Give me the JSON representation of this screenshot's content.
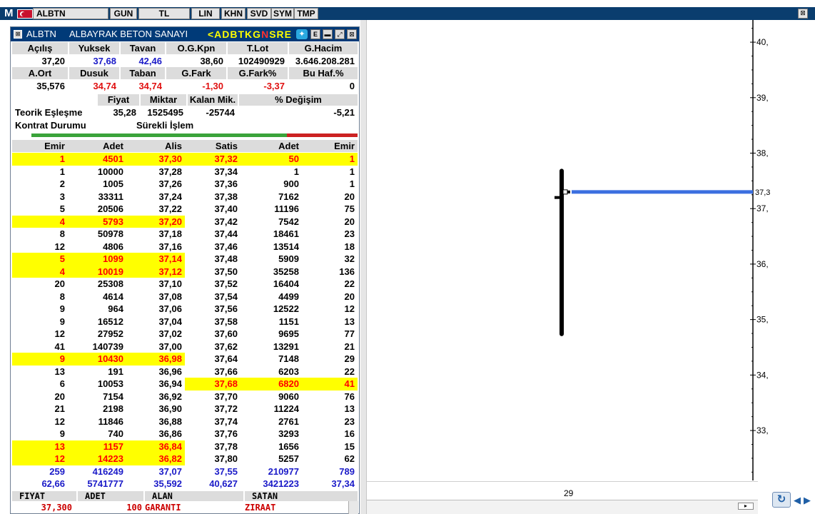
{
  "toolbar": {
    "menu_label": "M",
    "symbol": "ALBTN",
    "buttons": [
      "GUN",
      "TL",
      "LIN",
      "KHN",
      "SVD",
      "SYM",
      "TMP"
    ],
    "close_glyph": "⊠"
  },
  "depth": {
    "symbol": "ALBTN",
    "company": "ALBAYRAK BETON SANAYI",
    "ticker_a": "<ADBTKG",
    "ticker_b": "N",
    "ticker_c": "SRE",
    "btn_e": "E",
    "stats1": {
      "labels": [
        "Açılış",
        "Yuksek",
        "Tavan",
        "O.G.Kpn",
        "T.Lot",
        "G.Hacim"
      ],
      "values": [
        "37,20",
        "37,68",
        "42,46",
        "38,60",
        "102490929",
        "3.646.208.281"
      ]
    },
    "stats2": {
      "labels": [
        "A.Ort",
        "Dusuk",
        "Taban",
        "G.Fark",
        "G.Fark%",
        "Bu Haf.%"
      ],
      "values": [
        "35,576",
        "34,74",
        "34,74",
        "-1,30",
        "-3,37",
        "0"
      ]
    },
    "teorik": {
      "headers": [
        "Fiyat",
        "Miktar",
        "Kalan Mik.",
        "% Değişim"
      ],
      "row1_label": "Teorik Eşleşme",
      "row1_values": [
        "35,28",
        "1525495",
        "-25744",
        "-5,21"
      ],
      "row2_label": "Kontrat Durumu",
      "row2_value": "Sürekli İşlem"
    },
    "book_headers": [
      "Emir",
      "Adet",
      "Alis",
      "Satis",
      "Adet",
      "Emir"
    ],
    "book_rows": [
      {
        "c": [
          "1",
          "4501",
          "37,30",
          "37,32",
          "50",
          "1"
        ],
        "hb": true,
        "hs": true
      },
      {
        "c": [
          "1",
          "10000",
          "37,28",
          "37,34",
          "1",
          "1"
        ],
        "hb": false,
        "hs": false
      },
      {
        "c": [
          "2",
          "1005",
          "37,26",
          "37,36",
          "900",
          "1"
        ],
        "hb": false,
        "hs": false
      },
      {
        "c": [
          "3",
          "33311",
          "37,24",
          "37,38",
          "7162",
          "20"
        ],
        "hb": false,
        "hs": false
      },
      {
        "c": [
          "5",
          "20506",
          "37,22",
          "37,40",
          "11196",
          "75"
        ],
        "hb": false,
        "hs": false
      },
      {
        "c": [
          "4",
          "5793",
          "37,20",
          "37,42",
          "7542",
          "20"
        ],
        "hb": true,
        "hs": false
      },
      {
        "c": [
          "8",
          "50978",
          "37,18",
          "37,44",
          "18461",
          "23"
        ],
        "hb": false,
        "hs": false
      },
      {
        "c": [
          "12",
          "4806",
          "37,16",
          "37,46",
          "13514",
          "18"
        ],
        "hb": false,
        "hs": false
      },
      {
        "c": [
          "5",
          "1099",
          "37,14",
          "37,48",
          "5909",
          "32"
        ],
        "hb": true,
        "hs": false
      },
      {
        "c": [
          "4",
          "10019",
          "37,12",
          "37,50",
          "35258",
          "136"
        ],
        "hb": true,
        "hs": false
      },
      {
        "c": [
          "20",
          "25308",
          "37,10",
          "37,52",
          "16404",
          "22"
        ],
        "hb": false,
        "hs": false
      },
      {
        "c": [
          "8",
          "4614",
          "37,08",
          "37,54",
          "4499",
          "20"
        ],
        "hb": false,
        "hs": false
      },
      {
        "c": [
          "9",
          "964",
          "37,06",
          "37,56",
          "12522",
          "12"
        ],
        "hb": false,
        "hs": false
      },
      {
        "c": [
          "9",
          "16512",
          "37,04",
          "37,58",
          "1151",
          "13"
        ],
        "hb": false,
        "hs": false
      },
      {
        "c": [
          "12",
          "27952",
          "37,02",
          "37,60",
          "9695",
          "77"
        ],
        "hb": false,
        "hs": false
      },
      {
        "c": [
          "41",
          "140739",
          "37,00",
          "37,62",
          "13291",
          "21"
        ],
        "hb": false,
        "hs": false
      },
      {
        "c": [
          "9",
          "10430",
          "36,98",
          "37,64",
          "7148",
          "29"
        ],
        "hb": true,
        "hs": false
      },
      {
        "c": [
          "13",
          "191",
          "36,96",
          "37,66",
          "6203",
          "22"
        ],
        "hb": false,
        "hs": false
      },
      {
        "c": [
          "6",
          "10053",
          "36,94",
          "37,68",
          "6820",
          "41"
        ],
        "hb": false,
        "hs": true
      },
      {
        "c": [
          "20",
          "7154",
          "36,92",
          "37,70",
          "9060",
          "76"
        ],
        "hb": false,
        "hs": false
      },
      {
        "c": [
          "21",
          "2198",
          "36,90",
          "37,72",
          "11224",
          "13"
        ],
        "hb": false,
        "hs": false
      },
      {
        "c": [
          "12",
          "11846",
          "36,88",
          "37,74",
          "2761",
          "23"
        ],
        "hb": false,
        "hs": false
      },
      {
        "c": [
          "9",
          "740",
          "36,86",
          "37,76",
          "3293",
          "16"
        ],
        "hb": false,
        "hs": false
      },
      {
        "c": [
          "13",
          "1157",
          "36,84",
          "37,78",
          "1656",
          "15"
        ],
        "hb": true,
        "hs": false
      },
      {
        "c": [
          "12",
          "14223",
          "36,82",
          "37,80",
          "5257",
          "62"
        ],
        "hb": true,
        "hs": false
      }
    ],
    "summary_rows": [
      [
        "259",
        "416249",
        "37,07",
        "37,55",
        "210977",
        "789"
      ],
      [
        "62,66",
        "5741777",
        "35,592",
        "40,627",
        "3421223",
        "37,34"
      ]
    ],
    "trades": {
      "headers": [
        "FIYAT",
        "ADET",
        "ALAN",
        "SATAN"
      ],
      "row": [
        "37,300",
        "100",
        "GARANTI",
        "ZIRAAT"
      ]
    }
  },
  "chart_data": {
    "type": "candlestick",
    "y_ticks": [
      "40,",
      "39,",
      "38,",
      "37,",
      "36,",
      "35,",
      "34,",
      "33,"
    ],
    "y_tick_values": [
      40,
      39,
      38,
      37,
      36,
      35,
      34,
      33
    ],
    "ylim": [
      32.1,
      40.4
    ],
    "x_label": "29",
    "last_price_label": "37,3",
    "last_price": 37.3,
    "candle": {
      "open": 37.2,
      "high": 37.68,
      "low": 34.74,
      "close": 37.3
    },
    "colors": {
      "price_line": "#3b6fe0",
      "candle": "#000000",
      "axis": "#000000"
    }
  }
}
